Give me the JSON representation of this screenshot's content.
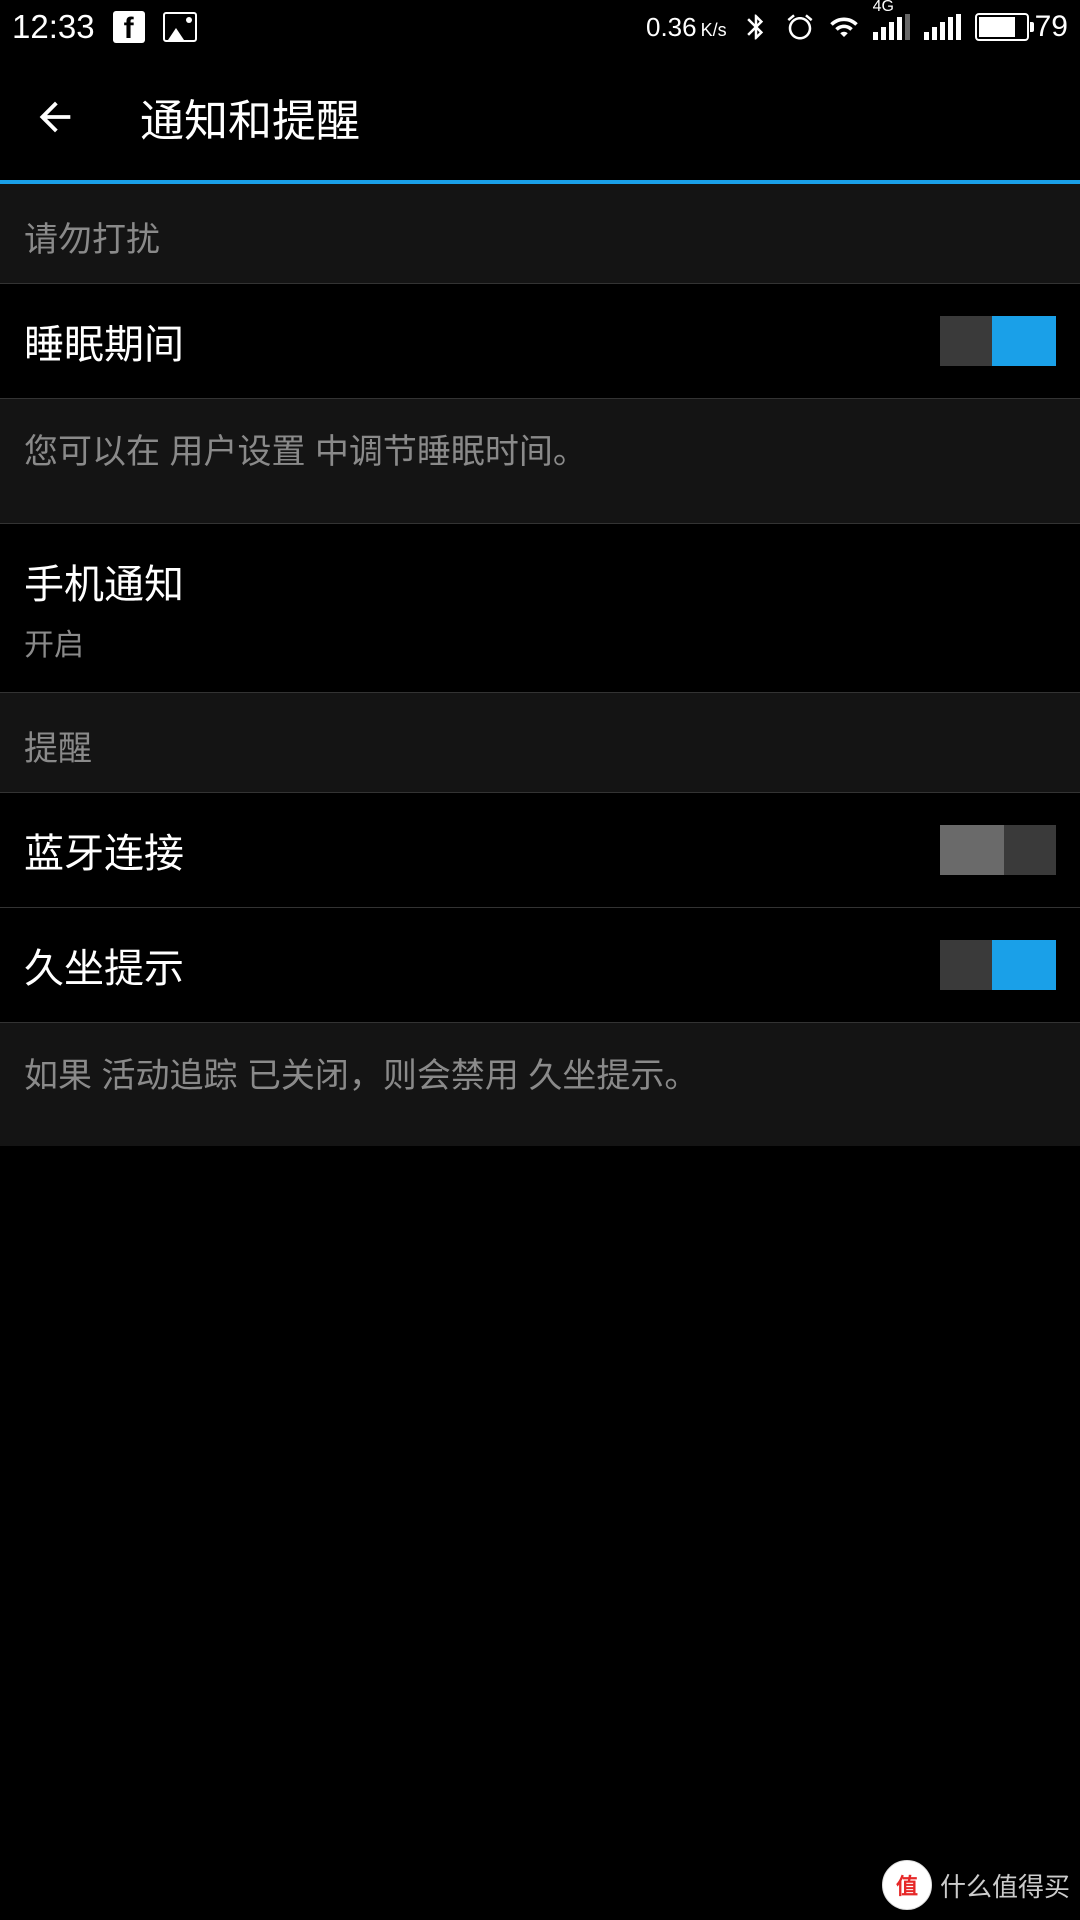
{
  "statusbar": {
    "time": "12:33",
    "speed_value": "0.36",
    "speed_unit": "K/s",
    "network_label": "4G",
    "battery_percent": "79"
  },
  "header": {
    "title": "通知和提醒"
  },
  "sections": {
    "dnd": {
      "title": "请勿打扰",
      "sleep_label": "睡眠期间",
      "sleep_info": "您可以在 用户设置 中调节睡眠时间。"
    },
    "phone_notif": {
      "label": "手机通知",
      "status": "开启"
    },
    "alerts": {
      "title": "提醒",
      "bluetooth_label": "蓝牙连接",
      "sedentary_label": "久坐提示",
      "sedentary_info": "如果 活动追踪 已关闭，则会禁用 久坐提示。"
    }
  },
  "watermark": {
    "badge_text": "值",
    "text": "什么值得买"
  }
}
